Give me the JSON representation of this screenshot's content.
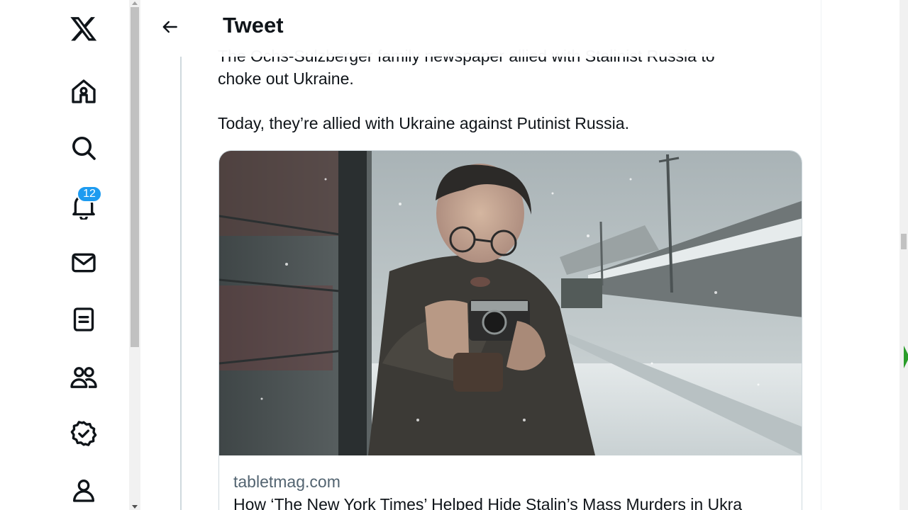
{
  "brand": {
    "logo": "x-logo",
    "accent": "#1d9bf0"
  },
  "sidebar": {
    "items": [
      {
        "name": "home",
        "icon": "home-icon"
      },
      {
        "name": "explore",
        "icon": "search-icon"
      },
      {
        "name": "notifications",
        "icon": "bell-icon",
        "badge": "12"
      },
      {
        "name": "messages",
        "icon": "mail-icon"
      },
      {
        "name": "lists",
        "icon": "list-icon"
      },
      {
        "name": "communities",
        "icon": "people-icon"
      },
      {
        "name": "verified",
        "icon": "verified-icon"
      },
      {
        "name": "profile",
        "icon": "profile-icon"
      }
    ]
  },
  "header": {
    "title": "Tweet",
    "back_icon": "arrow-left-icon"
  },
  "tweet": {
    "text_cut": "The Ochs-Sulzberger family newspaper allied with Stalinist Russia to",
    "text_line1": "choke out Ukraine.",
    "text_line2": "Today, they’re allied with Ukraine against Putinist Russia.",
    "card": {
      "image": "photo-of-man-with-camera-in-snowy-street",
      "domain": "tabletmag.com",
      "title": "How ‘The New York Times’ Helped Hide Stalin’s Mass Murders in Ukra"
    }
  }
}
